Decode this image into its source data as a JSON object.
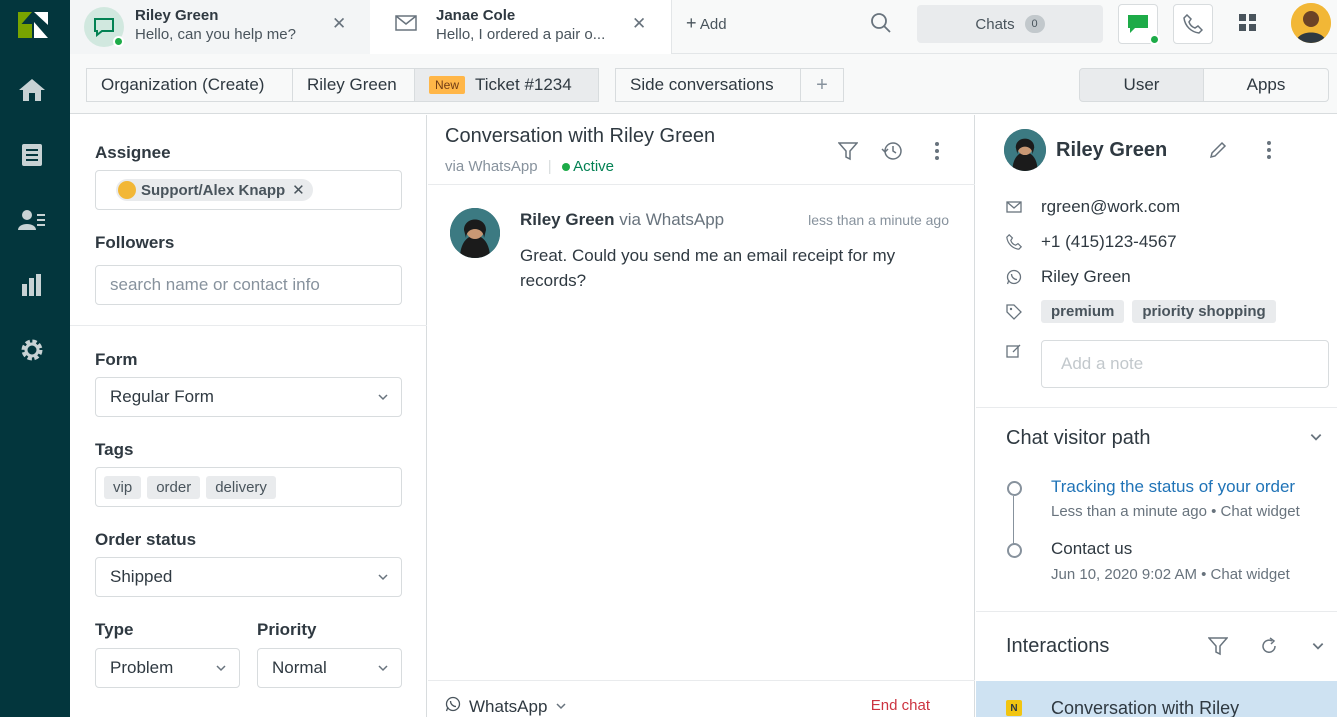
{
  "colors": {
    "nav_bg": "#03363d",
    "accent_green": "#1dab48",
    "link_blue": "#1f73b7",
    "new_badge": "#ffb648",
    "end_chat_red": "#cc3340"
  },
  "nav": {
    "icons": [
      "home-icon",
      "views-icon",
      "customers-icon",
      "reporting-icon",
      "settings-icon"
    ]
  },
  "tabs": [
    {
      "name": "Riley Green",
      "message": "Hello, can you help me?"
    },
    {
      "name": "Janae Cole",
      "message": "Hello, I ordered a pair o..."
    }
  ],
  "topbar": {
    "add_label": "Add",
    "chats_label": "Chats",
    "chats_count": "0"
  },
  "breadcrumbs": {
    "org": "Organization (Create)",
    "user": "Riley Green",
    "new_badge": "New",
    "ticket": "Ticket #1234",
    "side_conversations": "Side conversations",
    "plus": "+"
  },
  "context_toggle": {
    "user": "User",
    "apps": "Apps"
  },
  "ticket_form": {
    "assignee_label": "Assignee",
    "assignee_value": "Support/Alex Knapp",
    "followers_label": "Followers",
    "followers_placeholder": "search name or contact info",
    "form_label": "Form",
    "form_value": "Regular Form",
    "tags_label": "Tags",
    "tags": [
      "vip",
      "order",
      "delivery"
    ],
    "order_status_label": "Order status",
    "order_status_value": "Shipped",
    "type_label": "Type",
    "type_value": "Problem",
    "priority_label": "Priority",
    "priority_value": "Normal"
  },
  "conversation": {
    "title": "Conversation with Riley Green",
    "via": "via WhatsApp",
    "status": "Active",
    "message": {
      "sender": "Riley Green",
      "via": "via WhatsApp",
      "time": "less than a minute ago",
      "text": "Great. Could you send me an email receipt for my records?"
    },
    "footer_channel": "WhatsApp",
    "end_chat": "End chat"
  },
  "customer": {
    "name": "Riley Green",
    "email": "rgreen@work.com",
    "phone": "+1 (415)123-4567",
    "whatsapp": "Riley Green",
    "tags": [
      "premium",
      "priority shopping"
    ],
    "note_placeholder": "Add a note"
  },
  "visitor_path": {
    "title": "Chat visitor path",
    "items": [
      {
        "title": "Tracking the status of your order",
        "meta": "Less than a minute ago • Chat widget"
      },
      {
        "title": "Contact us",
        "meta": "Jun 10, 2020 9:02 AM • Chat widget"
      }
    ]
  },
  "interactions": {
    "title": "Interactions",
    "badge": "N",
    "item": "Conversation with Riley"
  }
}
